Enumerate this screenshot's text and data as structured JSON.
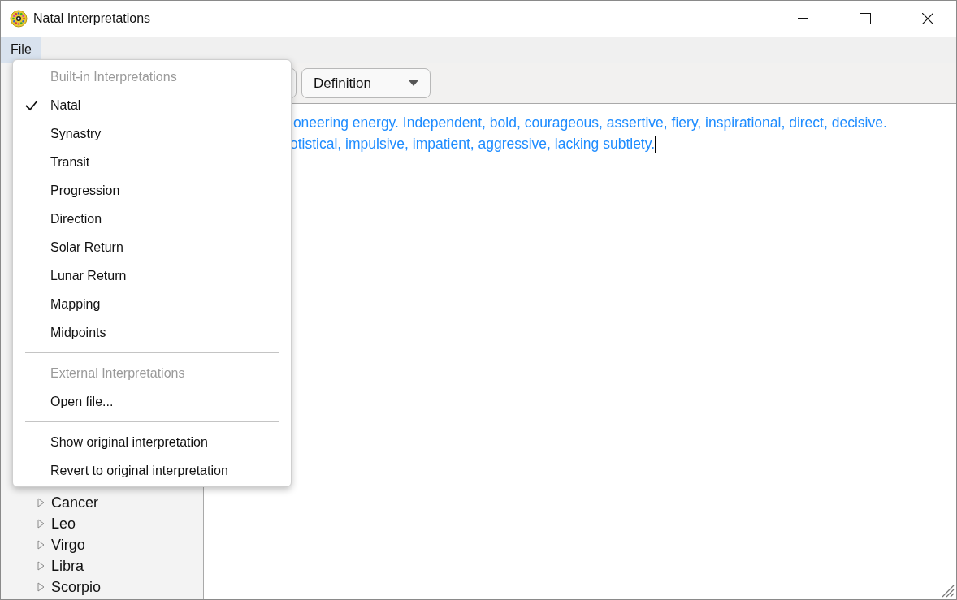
{
  "window": {
    "title": "Natal Interpretations"
  },
  "menu_bar": [
    {
      "label": "File",
      "selected": true
    }
  ],
  "toolbar": {
    "section_dropdown": {
      "value": "Definition"
    }
  },
  "tree": [
    {
      "label": "Cancer",
      "expanded": false
    },
    {
      "label": "Leo",
      "expanded": false
    },
    {
      "label": "Virgo",
      "expanded": false
    },
    {
      "label": "Libra",
      "expanded": false
    },
    {
      "label": "Scorpio",
      "expanded": false
    }
  ],
  "editor": {
    "lines": [
      "ioneering energy. Independent, bold, courageous, assertive, fiery, inspirational, direct, decisive.",
      "otistical, impulsive, impatient, aggressive, lacking subtlety."
    ]
  },
  "file_menu": [
    {
      "kind": "header",
      "label": "Built-in Interpretations"
    },
    {
      "kind": "item",
      "label": "Natal",
      "checked": true
    },
    {
      "kind": "item",
      "label": "Synastry",
      "checked": false
    },
    {
      "kind": "item",
      "label": "Transit",
      "checked": false
    },
    {
      "kind": "item",
      "label": "Progression",
      "checked": false
    },
    {
      "kind": "item",
      "label": "Direction",
      "checked": false
    },
    {
      "kind": "item",
      "label": "Solar Return",
      "checked": false
    },
    {
      "kind": "item",
      "label": "Lunar Return",
      "checked": false
    },
    {
      "kind": "item",
      "label": "Mapping",
      "checked": false
    },
    {
      "kind": "item",
      "label": "Midpoints",
      "checked": false
    },
    {
      "kind": "separator"
    },
    {
      "kind": "header",
      "label": "External Interpretations"
    },
    {
      "kind": "item",
      "label": "Open file...",
      "checked": false
    },
    {
      "kind": "separator"
    },
    {
      "kind": "item",
      "label": "Show original interpretation",
      "checked": false
    },
    {
      "kind": "item",
      "label": "Revert to original interpretation",
      "checked": false
    }
  ]
}
